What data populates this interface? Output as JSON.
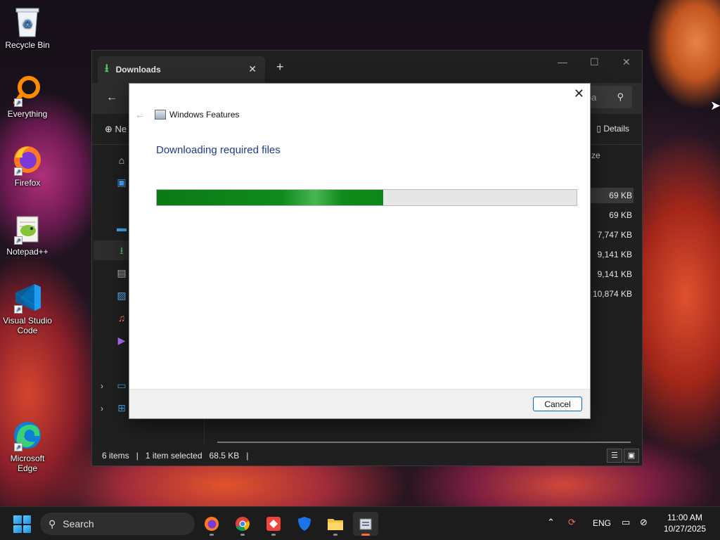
{
  "desktop": {
    "icons": [
      {
        "label": "Recycle Bin"
      },
      {
        "label": "Everything"
      },
      {
        "label": "Firefox"
      },
      {
        "label": "Notepad++"
      },
      {
        "label": "Visual Studio Code"
      },
      {
        "label": "Microsoft Edge"
      }
    ]
  },
  "explorer": {
    "tab_title": "Downloads",
    "new_tab_label": "+",
    "search_placeholder": "loa",
    "new_label": "Ne",
    "details_label": "Details",
    "size_column_header": "ze",
    "sizes": [
      "69 KB",
      "69 KB",
      "7,747 KB",
      "9,141 KB",
      "9,141 KB",
      "10,874 KB"
    ],
    "status": {
      "items_count": "6 items",
      "selected": "1 item selected",
      "selected_size": "68.5 KB"
    }
  },
  "dialog": {
    "title": "Windows Features",
    "heading": "Downloading required files",
    "progress_fraction": 0.54,
    "cancel_label": "Cancel",
    "progress_color": "#0f8a1c"
  },
  "taskbar": {
    "search_label": "Search",
    "apps": [
      "firefox-icon",
      "chrome-icon",
      "anydesk-icon",
      "defender-icon",
      "file-explorer-icon",
      "windows-features-icon"
    ],
    "language": "ENG",
    "time": "11:00 AM",
    "date": "10/27/2025"
  }
}
